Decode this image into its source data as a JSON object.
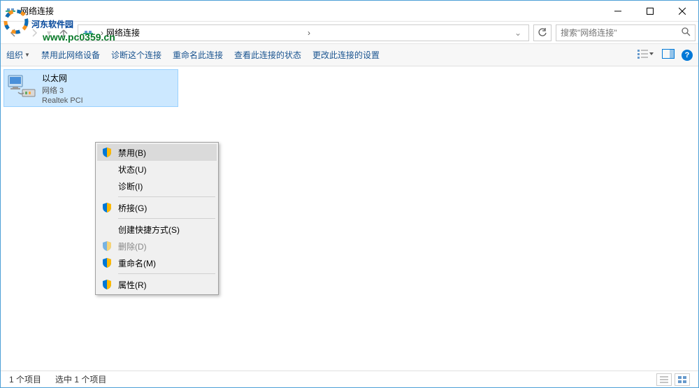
{
  "window": {
    "title": "网络连接"
  },
  "watermark": {
    "text": "河东软件园",
    "url": "www.pc0359.cn"
  },
  "nav": {
    "breadcrumb_text": "网络连接",
    "breadcrumb_arrow": "›",
    "search_placeholder": "搜索\"网络连接\""
  },
  "toolbar": {
    "organize": "组织",
    "disable_device": "禁用此网络设备",
    "diagnose": "诊断这个连接",
    "rename": "重命名此连接",
    "view_status": "查看此连接的状态",
    "change_settings": "更改此连接的设置"
  },
  "network_item": {
    "name": "以太网",
    "subtitle1": "网络  3",
    "subtitle2": "Realtek PCI"
  },
  "context_menu": {
    "disable": "禁用(B)",
    "status": "状态(U)",
    "diagnose": "诊断(I)",
    "bridge": "桥接(G)",
    "create_shortcut": "创建快捷方式(S)",
    "delete": "删除(D)",
    "rename": "重命名(M)",
    "properties": "属性(R)"
  },
  "statusbar": {
    "items": "1 个项目",
    "selected": "选中 1 个项目"
  }
}
